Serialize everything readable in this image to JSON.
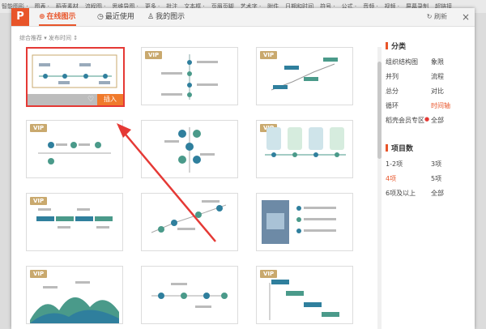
{
  "ribbon": {
    "items": [
      "智能图形 ·",
      "图表 ·",
      "稻壳素材",
      "流程图 ·",
      "思维导图 ·",
      "更多 ·",
      "批注",
      "文本框 ·",
      "页眉页脚",
      "艺术字 ·",
      "附件",
      "日期和时间",
      "符号 ·",
      "公式 ·",
      "音频 ·",
      "视频 ·",
      "屏幕录制",
      "超链接"
    ]
  },
  "dialog": {
    "tabs": [
      {
        "label": "在线图示",
        "icon": "globe-icon",
        "active": true
      },
      {
        "label": "最近使用",
        "icon": "clock-icon",
        "active": false
      },
      {
        "label": "我的图示",
        "icon": "user-icon",
        "active": false
      }
    ],
    "refresh_label": "刷新",
    "close_glyph": "×",
    "breadcrumb": "综合推荐 ▾    发布时间 ↕",
    "vip_badge": "VIP",
    "insert_label": "插入",
    "heart_glyph": "♡"
  },
  "panel": {
    "category_title": "分类",
    "categories": [
      "组织结构图",
      "象限",
      "并列",
      "流程",
      "总分",
      "对比",
      "循环",
      "时间轴",
      "稻壳会员专区",
      "全部"
    ],
    "category_active": "时间轴",
    "count_title": "项目数",
    "counts": [
      "1-2项",
      "3项",
      "4项",
      "5项",
      "6项及以上",
      "全部"
    ],
    "count_active": "4项"
  },
  "colors": {
    "accent": "#e8552a",
    "selection": "#e53935",
    "vip": "#c9a96e"
  }
}
